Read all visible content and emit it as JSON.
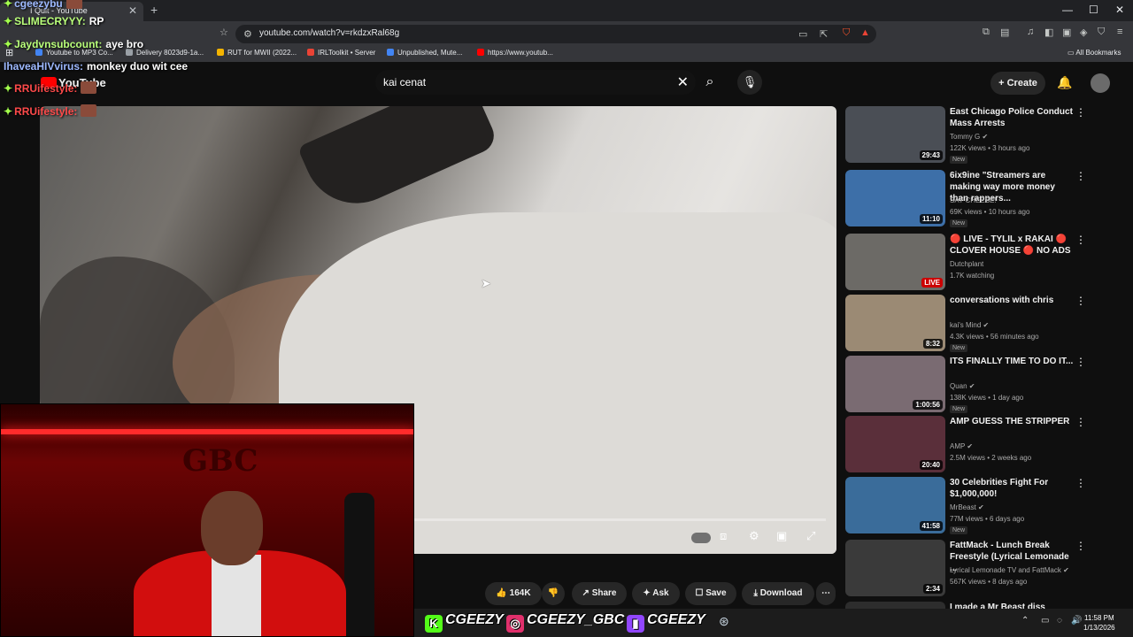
{
  "browser": {
    "tab_title": "I Quit - YouTube",
    "tab_close": "✕",
    "new_tab": "+",
    "url": "youtube.com/watch?v=rkdzxRal68g",
    "window_controls": [
      "—",
      "☐",
      "✕"
    ],
    "bookmarks": [
      {
        "label": "Youtube to MP3 Co...",
        "color": "#4285f4"
      },
      {
        "label": "Delivery 8023d9-1a...",
        "color": "#9aa0a6"
      },
      {
        "label": "RUT for MWII (2022...",
        "color": "#f4b400"
      },
      {
        "label": "IRLToolkit • Server",
        "color": "#ea4335"
      },
      {
        "label": "Unpublished, Mute...",
        "color": "#4285f4"
      },
      {
        "label": "https://www.youtub...",
        "color": "#ff0000"
      }
    ],
    "all_bookmarks": "All Bookmarks"
  },
  "youtube": {
    "logo_text": "YouTube",
    "search_query": "kai cenat",
    "create_label": "Create",
    "actions": {
      "likes": "164K",
      "share": "Share",
      "ask": "Ask",
      "save": "Save",
      "download": "Download"
    }
  },
  "recommendations": [
    {
      "title": "East Chicago Police Conduct Mass Arrests",
      "channel": "Tommy G",
      "verified": true,
      "meta": "122K views • 3 hours ago",
      "new": "New",
      "duration": "29:43",
      "live": false,
      "thumb": "#4a4e55"
    },
    {
      "title": "6ix9ine \"Streamers are making way more money than rappers...",
      "channel": "SAY CHEESE!",
      "verified": false,
      "meta": "69K views • 10 hours ago",
      "new": "New",
      "duration": "11:10",
      "live": false,
      "thumb": "#3d6fa8"
    },
    {
      "title": "🔴 LIVE - TYLIL x RAKAI 🔴 CLOVER HOUSE 🔴 NO ADS",
      "channel": "Dutchplant",
      "verified": false,
      "meta": "1.7K watching",
      "new": "",
      "duration": "LIVE",
      "live": true,
      "thumb": "#6c6a66"
    },
    {
      "title": "conversations with chris",
      "channel": "kai's Mind",
      "verified": true,
      "meta": "4.3K views • 56 minutes ago",
      "new": "New",
      "duration": "8:32",
      "live": false,
      "thumb": "#9b8a74"
    },
    {
      "title": "ITS FINALLY TIME TO DO IT...",
      "channel": "Quan",
      "verified": true,
      "meta": "138K views • 1 day ago",
      "new": "New",
      "duration": "1:00:56",
      "live": false,
      "thumb": "#7a6b72"
    },
    {
      "title": "AMP GUESS THE STRIPPER",
      "channel": "AMP",
      "verified": true,
      "meta": "2.5M views • 2 weeks ago",
      "new": "",
      "duration": "20:40",
      "live": false,
      "thumb": "#5a2f3a"
    },
    {
      "title": "30 Celebrities Fight For $1,000,000!",
      "channel": "MrBeast",
      "verified": true,
      "meta": "77M views • 6 days ago",
      "new": "New",
      "duration": "41:58",
      "live": false,
      "thumb": "#3a6c9a"
    },
    {
      "title": "FattMack - Lunch Break Freestyle (Lyrical Lemonade ...",
      "channel": "Lyrical Lemonade TV and FattMack",
      "verified": true,
      "meta": "567K views • 8 days ago",
      "new": "",
      "duration": "2:34",
      "live": false,
      "thumb": "#3a3a3a"
    },
    {
      "title": "I made a Mr Beast diss track!!",
      "channel": "",
      "verified": false,
      "meta": "",
      "new": "",
      "duration": "",
      "live": false,
      "thumb": "#2d2d2d"
    }
  ],
  "chat": [
    {
      "user": "cgeezybu",
      "message": "",
      "color": "purple"
    },
    {
      "user": "SLIMECRYYY:",
      "message": "RP",
      "color": "green"
    },
    {
      "user": "Jaydvnsubcount:",
      "message": "aye bro",
      "color": "green"
    },
    {
      "user": "IhaveaHIVvirus:",
      "message": "monkey duo wit cee",
      "color": "blue"
    },
    {
      "user": "RRUifestyle:",
      "message": "",
      "color": "red"
    },
    {
      "user": "RRUifestyle:",
      "message": "",
      "color": "red"
    }
  ],
  "webcam": {
    "sign_text": "GBC"
  },
  "overlay_socials": [
    {
      "icon": "K",
      "handle": "CGEEZY",
      "color": "#53fc18"
    },
    {
      "icon": "◎",
      "handle": "CGEEZY_GBC",
      "color": "#e1306c"
    },
    {
      "icon": "▮",
      "handle": "CGEEZY",
      "color": "#9146ff"
    }
  ],
  "taskbar": {
    "time": "11:58 PM",
    "date": "1/13/2026"
  }
}
